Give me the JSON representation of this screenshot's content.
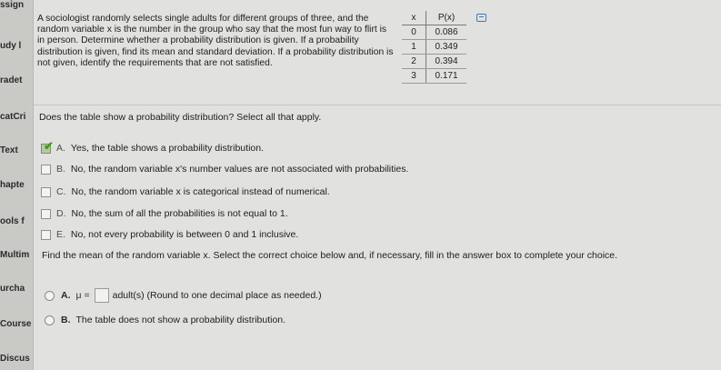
{
  "sidebar": {
    "items": [
      "ssign",
      "udy l",
      "radet",
      "catCri",
      "Text",
      "hapte",
      "ools f",
      "Multim",
      "urcha",
      "Course",
      "Discus"
    ]
  },
  "question": {
    "text": "A sociologist randomly selects single adults for different groups of three, and the random variable x is the number in the group who say that the most fun way to flirt is in person. Determine whether a probability distribution is given. If a probability distribution is given, find its mean and standard deviation. If a probability distribution is not given, identify the requirements that are not satisfied."
  },
  "table": {
    "headers": [
      "x",
      "P(x)"
    ],
    "rows": [
      [
        "0",
        "0.086"
      ],
      [
        "1",
        "0.349"
      ],
      [
        "2",
        "0.394"
      ],
      [
        "3",
        "0.171"
      ]
    ]
  },
  "part1": {
    "prompt": "Does the table show a probability distribution? Select all that apply.",
    "options": [
      {
        "letter": "A.",
        "text": "Yes, the table shows a probability distribution.",
        "checked": true
      },
      {
        "letter": "B.",
        "text": "No, the random variable x's number values are not associated with probabilities.",
        "checked": false
      },
      {
        "letter": "C.",
        "text": "No, the random variable x is categorical instead of numerical.",
        "checked": false
      },
      {
        "letter": "D.",
        "text": "No, the sum of all the probabilities is not equal to 1.",
        "checked": false
      },
      {
        "letter": "E.",
        "text": "No, not every probability is between 0 and 1 inclusive.",
        "checked": false
      }
    ]
  },
  "part2": {
    "prompt": "Find the mean of the random variable x. Select the correct choice below and, if necessary, fill in the answer box to complete your choice.",
    "options": [
      {
        "letter": "A.",
        "prefix": "μ =",
        "text": "adult(s) (Round to one decimal place as needed.)"
      },
      {
        "letter": "B.",
        "text": "The table does not show a probability distribution."
      }
    ]
  },
  "colors": {
    "check": "#3e9a1f",
    "link": "#3f78b8"
  }
}
